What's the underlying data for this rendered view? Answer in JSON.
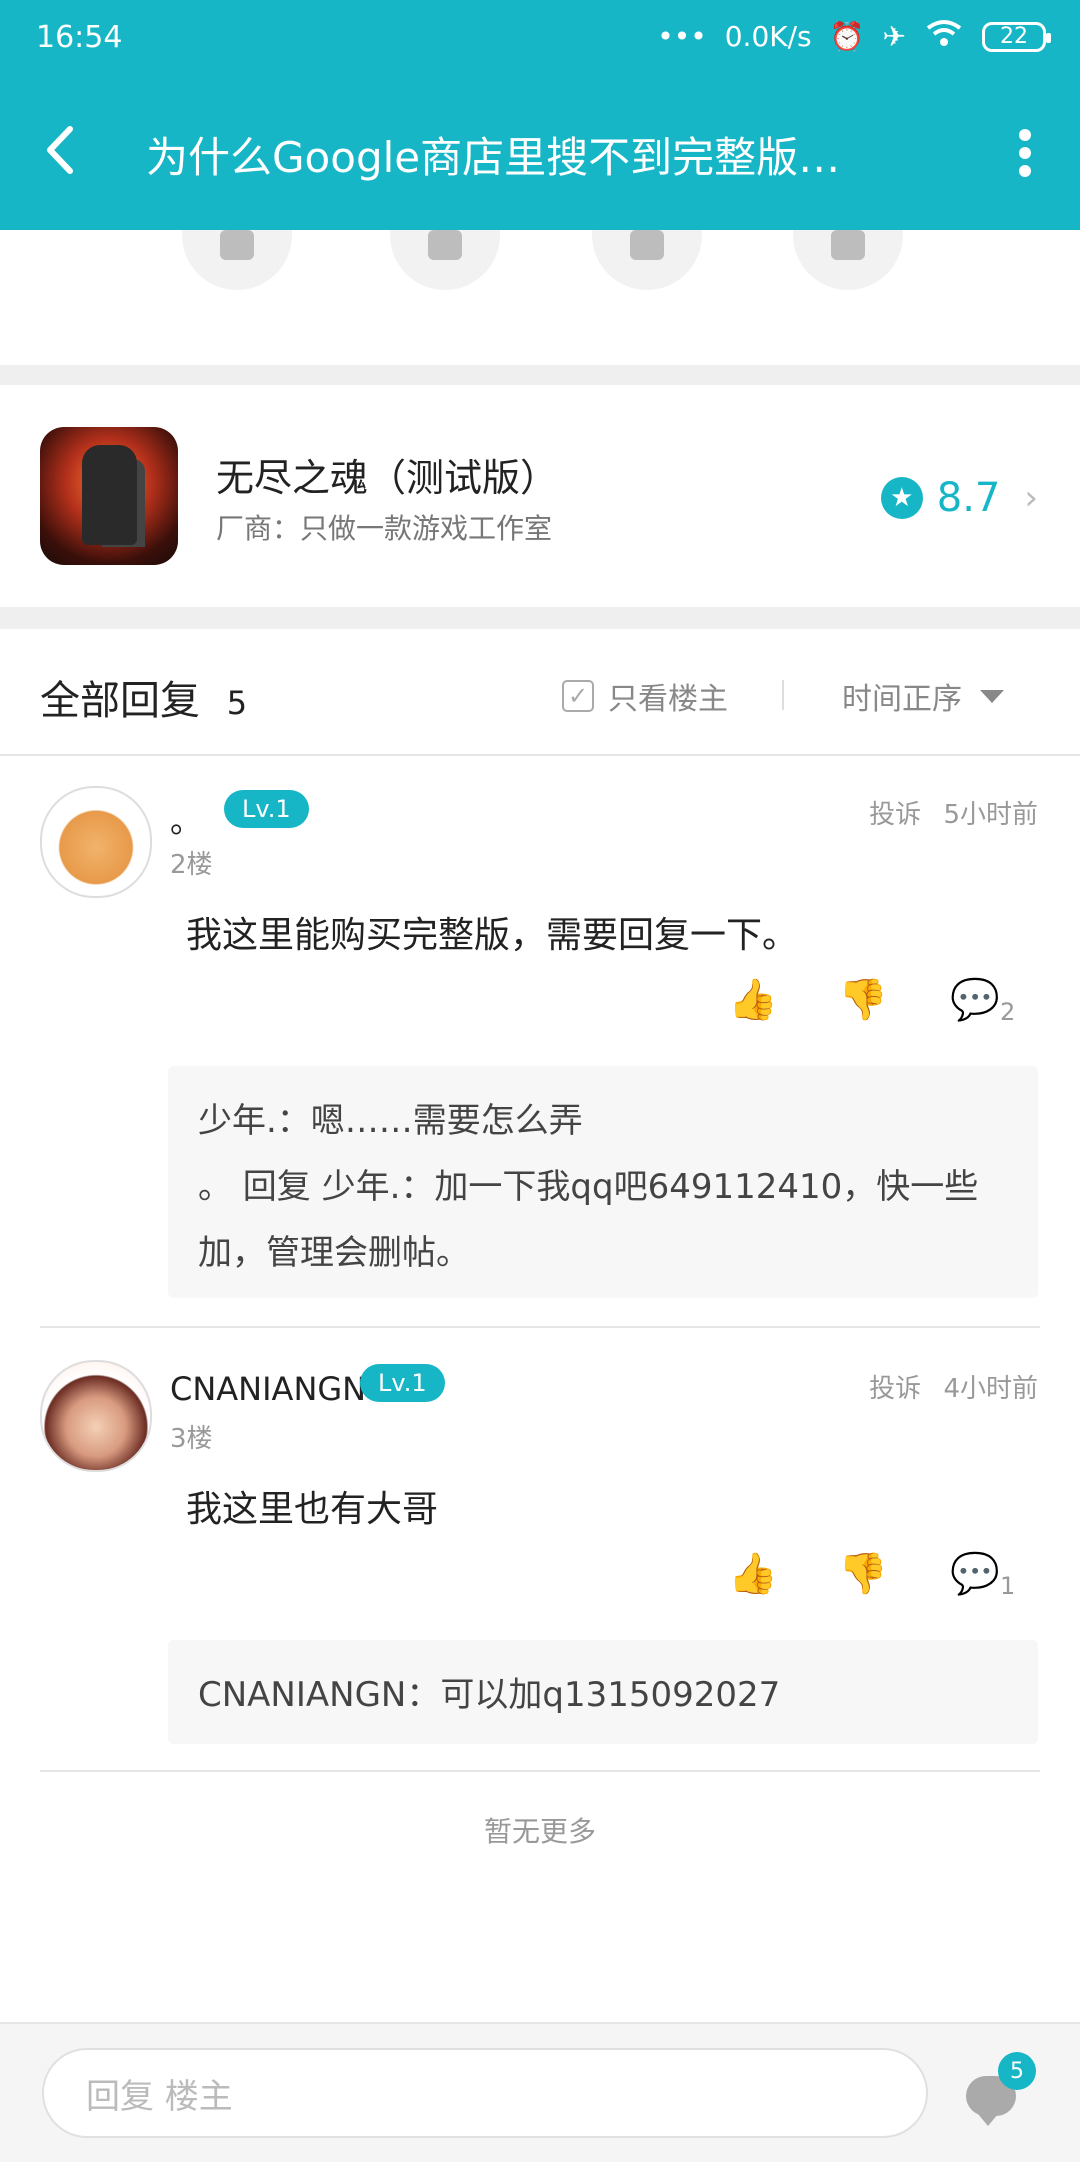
{
  "status_bar": {
    "time": "16:54",
    "net_speed": "0.0K/s",
    "battery": "22"
  },
  "header": {
    "title": "为什么Google商店里搜不到完整版…",
    "back_icon": "back-arrow-icon",
    "menu_icon": "more-vert-icon"
  },
  "game": {
    "name": "无尽之魂（测试版）",
    "vendor": "厂商：只做一款游戏工作室",
    "rating": "8.7"
  },
  "replies_header": {
    "label": "全部回复",
    "count": "5",
    "only_op": "只看楼主",
    "sort": "时间正序"
  },
  "replies": [
    {
      "username": "。",
      "level": "Lv.1",
      "floor": "2楼",
      "report": "投诉",
      "time": "5小时前",
      "content": "我这里能购买完整版，需要回复一下。",
      "comment_count": "2",
      "sub_replies": [
        "少年.：嗯……需要怎么弄",
        "。 回复 少年.：加一下我qq吧649112410，快一些加，管理会删帖。"
      ]
    },
    {
      "username": "CNANIANGN",
      "level": "Lv.1",
      "floor": "3楼",
      "report": "投诉",
      "time": "4小时前",
      "content": "我这里也有大哥",
      "comment_count": "1",
      "sub_replies": [
        "CNANIANGN：可以加q1315092027"
      ]
    }
  ],
  "no_more": "暂无更多",
  "bottom": {
    "reply_placeholder": "回复  楼主",
    "badge_count": "5"
  },
  "colors": {
    "accent": "#16b6c7"
  }
}
